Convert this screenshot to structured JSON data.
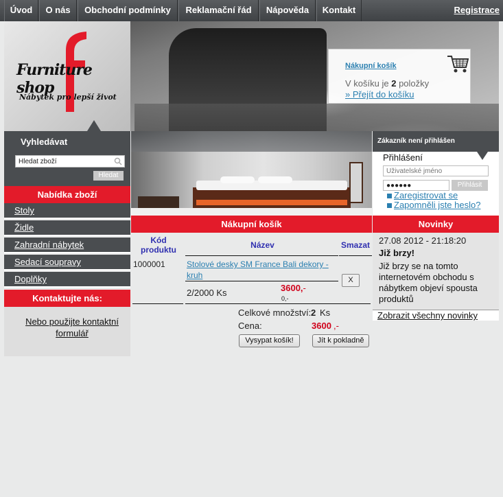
{
  "nav": {
    "items": [
      "Úvod",
      "O nás",
      "Obchodní podmínky",
      "Reklamační řád",
      "Nápověda",
      "Kontakt"
    ],
    "register": "Registrace"
  },
  "logo": {
    "title": "Furniture shop",
    "subtitle": "Nábytek pro lepší život"
  },
  "cart_box": {
    "title": "Nákupní košík",
    "count_prefix": "V košíku je",
    "count": "2",
    "count_suffix": "položky",
    "goto": "» Přejít do košíku"
  },
  "search": {
    "title": "Vyhledávat",
    "placeholder": "Hledat zboží",
    "button": "Hledat"
  },
  "menu": {
    "heading": "Nabídka zboží",
    "items": [
      "Stoly",
      "Židle",
      "Zahradní nábytek",
      "Sedací soupravy",
      "Doplňky"
    ]
  },
  "contact": {
    "heading": "Kontaktujte nás:",
    "link": "Nebo použijte kontaktní formulář"
  },
  "login": {
    "status": "Zákazník není přihlášen",
    "title": "Přihlášení",
    "username_placeholder": "Uživatelské jméno",
    "password_value": "●●●●●●",
    "button": "Přihlásit",
    "register_link": "Zaregistrovat se",
    "forgot_link": "Zapomněli jste heslo?"
  },
  "cart": {
    "heading": "Nákupní košík",
    "columns": [
      "Kód produktu",
      "Název",
      "Smazat"
    ],
    "item": {
      "code": "1000001",
      "name": "Stolové desky SM France Bali dekory - kruh",
      "delete": "X",
      "qty": "2/2000 Ks",
      "price": "3600,",
      "price_suffix": "-",
      "price_small": "0,-"
    },
    "total_qty_label": "Celkové množství:",
    "total_qty": "2",
    "total_qty_unit": "Ks",
    "price_label": "Cena:",
    "price": "3600",
    "price_suffix": ",-",
    "empty_button": "Vysypat košík!",
    "checkout_button": "Jít k pokladně"
  },
  "news": {
    "heading": "Novinky",
    "date": "27.08 2012 - 21:18:20",
    "title": "Již brzy!",
    "text": "Již brzy se na tomto internetovém obchodu s nábytkem objeví spousta produktů",
    "all_link": "Zobrazit všechny novinky"
  },
  "colors": {
    "accent_red": "#e31b2a",
    "dark_panel": "#4a4d50",
    "link_blue": "#2a7fb0",
    "header_blue": "#3030b0"
  }
}
